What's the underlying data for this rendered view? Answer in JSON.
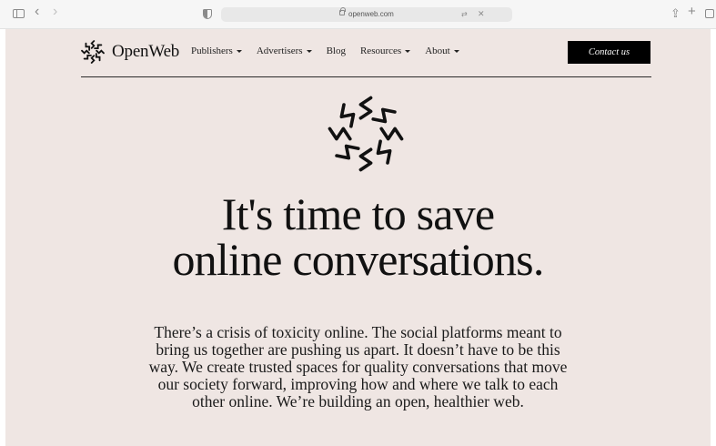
{
  "browser": {
    "url": "openweb.com"
  },
  "site": {
    "brand": "OpenWeb",
    "nav": [
      {
        "label": "Publishers",
        "has_dropdown": true
      },
      {
        "label": "Advertisers",
        "has_dropdown": true
      },
      {
        "label": "Blog",
        "has_dropdown": false
      },
      {
        "label": "Resources",
        "has_dropdown": true
      },
      {
        "label": "About",
        "has_dropdown": true
      }
    ],
    "cta_label": "Contact us"
  },
  "hero": {
    "headline_lines": [
      "It's time to save",
      "online conversations."
    ],
    "body_lines": [
      "There’s a crisis of toxicity online. The social platforms meant to",
      "bring us together are pushing us apart. It doesn’t have to be this",
      "way. We create trusted spaces for quality conversations that move",
      "our society forward, improving how and where we talk to each",
      "other online. We’re building an open, healthier web."
    ]
  },
  "colors": {
    "page_background": "#efe6e3",
    "text": "#111111",
    "button_background": "#000000",
    "button_text": "#ffffff"
  },
  "icons": [
    "sidebar-icon",
    "back-icon",
    "forward-icon",
    "privacy-shield-icon",
    "lock-icon",
    "translate-icon",
    "close-icon",
    "share-icon",
    "new-tab-icon",
    "tab-overview-icon",
    "openweb-logo-icon",
    "openweb-emblem-icon"
  ]
}
